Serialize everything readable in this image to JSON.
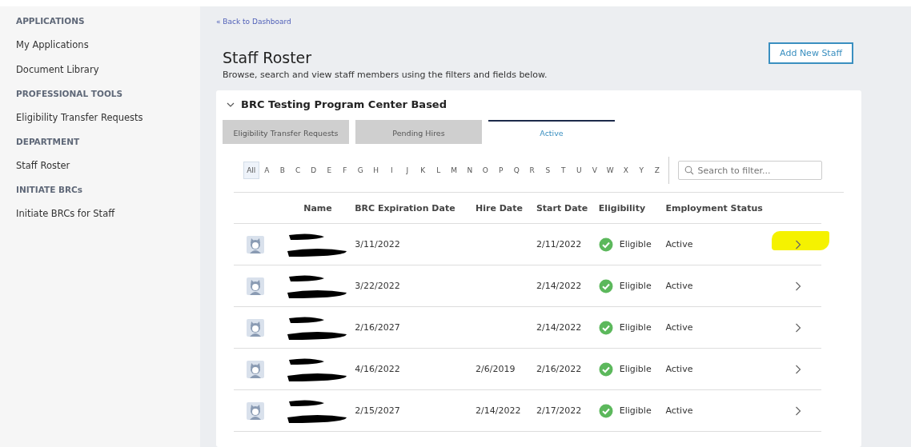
{
  "sidebar": {
    "sections": [
      {
        "heading": "APPLICATIONS",
        "items": [
          {
            "label": "My Applications"
          },
          {
            "label": "Document Library"
          }
        ]
      },
      {
        "heading": "PROFESSIONAL TOOLS",
        "items": [
          {
            "label": "Eligibility Transfer Requests"
          }
        ]
      },
      {
        "heading": "DEPARTMENT",
        "items": [
          {
            "label": "Staff Roster"
          }
        ]
      },
      {
        "heading": "INITIATE BRCs",
        "items": [
          {
            "label": "Initiate BRCs for Staff"
          }
        ]
      }
    ]
  },
  "back_link": "« Back to Dashboard",
  "page": {
    "title": "Staff Roster",
    "subtitle": "Browse, search and view staff members using the filters and fields below.",
    "add_button": "Add New Staff"
  },
  "panel": {
    "title": "BRC Testing Program Center Based",
    "expanded": true,
    "tabs": [
      {
        "label": "Eligibility Transfer Requests",
        "selected": false
      },
      {
        "label": "Pending Hires",
        "selected": false
      },
      {
        "label": "Active",
        "selected": true
      }
    ],
    "letters": [
      {
        "label": "All",
        "selected": true
      },
      {
        "label": "A",
        "selected": false
      },
      {
        "label": "B",
        "selected": false
      },
      {
        "label": "C",
        "selected": false
      },
      {
        "label": "D",
        "selected": false
      },
      {
        "label": "E",
        "selected": false
      },
      {
        "label": "F",
        "selected": false
      },
      {
        "label": "G",
        "selected": false
      },
      {
        "label": "H",
        "selected": false
      },
      {
        "label": "I",
        "selected": false
      },
      {
        "label": "J",
        "selected": false
      },
      {
        "label": "K",
        "selected": false
      },
      {
        "label": "L",
        "selected": false
      },
      {
        "label": "M",
        "selected": false
      },
      {
        "label": "N",
        "selected": false
      },
      {
        "label": "O",
        "selected": false
      },
      {
        "label": "P",
        "selected": false
      },
      {
        "label": "Q",
        "selected": false
      },
      {
        "label": "R",
        "selected": false
      },
      {
        "label": "S",
        "selected": false
      },
      {
        "label": "T",
        "selected": false
      },
      {
        "label": "U",
        "selected": false
      },
      {
        "label": "V",
        "selected": false
      },
      {
        "label": "W",
        "selected": false
      },
      {
        "label": "X",
        "selected": false
      },
      {
        "label": "Y",
        "selected": false
      },
      {
        "label": "Z",
        "selected": false
      }
    ],
    "search": {
      "placeholder": "Search to filter..."
    },
    "table": {
      "columns": [
        "Name",
        "BRC Expiration Date",
        "Hire Date",
        "Start Date",
        "Eligibility",
        "Employment Status"
      ],
      "rows": [
        {
          "brc_expiration": "3/11/2022",
          "start_date": "2/11/2022",
          "eligibility": "Eligible",
          "status": "Active",
          "highlighted": true
        },
        {
          "brc_expiration": "3/22/2022",
          "start_date": "2/14/2022",
          "eligibility": "Eligible",
          "status": "Active",
          "highlighted": false
        },
        {
          "brc_expiration": "2/16/2027",
          "start_date": "2/14/2022",
          "eligibility": "Eligible",
          "status": "Active",
          "highlighted": false
        },
        {
          "brc_expiration": "4/16/2022",
          "hire_date": "2/6/2019",
          "start_date": "2/16/2022",
          "eligibility": "Eligible",
          "status": "Active",
          "highlighted": false
        },
        {
          "brc_expiration": "2/15/2027",
          "hire_date": "2/14/2022",
          "start_date": "2/17/2022",
          "eligibility": "Eligible",
          "status": "Active",
          "highlighted": false
        }
      ]
    }
  }
}
